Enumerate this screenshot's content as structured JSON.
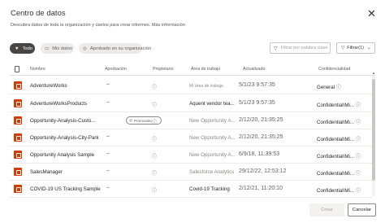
{
  "dialog": {
    "title": "Centro de datos",
    "subtitle": "Descubra datos de toda la organización y úselos para crear informes.",
    "more_info": "Más información"
  },
  "filters": {
    "all_label": "Todo",
    "mine_label": "Mis datos",
    "org_label": "Aprobado en su organización",
    "search_placeholder": "Filtrar por palabra clave",
    "filter_button": "Filtrar(1)"
  },
  "table": {
    "columns": {
      "name": "Nombre",
      "approval": "Aprobación",
      "owner": "Propietario",
      "workspace": "Área de trabajo",
      "updated": "Actualizado",
      "sensitivity": "Confidencialidad"
    },
    "rows": [
      {
        "name": "AdventureWorks",
        "approval": "–",
        "badge": "",
        "workspace": "Mi área de trabajo",
        "updated": "5/1/23 9:57:35",
        "sensitivity": "General"
      },
      {
        "name": "AdventureWorksProducts",
        "approval": "–",
        "badge": "",
        "workspace": "Aquent vendor tea...",
        "updated": "5/1/23 9:57:35",
        "sensitivity": "Confidential\\Mi..."
      },
      {
        "name": "Opportunity-Analysis-Custo...",
        "approval": "",
        "badge": "Promovido",
        "workspace": "New Opportunity A...",
        "updated": "2/12/20, 21:35:25",
        "sensitivity": "Confidential\\Mi..."
      },
      {
        "name": "Opportunity-Analysis-City-Park",
        "approval": "–",
        "badge": "",
        "workspace": "New Opportunity A...",
        "updated": "2/12/20, 21:35:25",
        "sensitivity": "Confidential\\Mi..."
      },
      {
        "name": "Opportunity Analysis Sample",
        "approval": "–",
        "badge": "",
        "workspace": "New Opportunity A...",
        "updated": "6/9/18, 11:39:53",
        "sensitivity": "Confidential\\Mi..."
      },
      {
        "name": "SalesManager",
        "approval": "–",
        "badge": "",
        "workspace": "Salesforce Analytics",
        "updated": "29/12/22, 12:53:12",
        "sensitivity": "Confidential\\Mi..."
      },
      {
        "name": "COVID-19 US Tracking Sample",
        "approval": "–",
        "badge": "",
        "workspace": "Covid-19 Tracking",
        "updated": "2/12/21, 11:20:10",
        "sensitivity": "Confidential\\Mi..."
      }
    ]
  },
  "footer": {
    "create_label": "Crear",
    "cancel_label": "Cancelar"
  },
  "colors": {
    "accent_dark": "#484644",
    "dataset_icon": "#d83b01"
  }
}
